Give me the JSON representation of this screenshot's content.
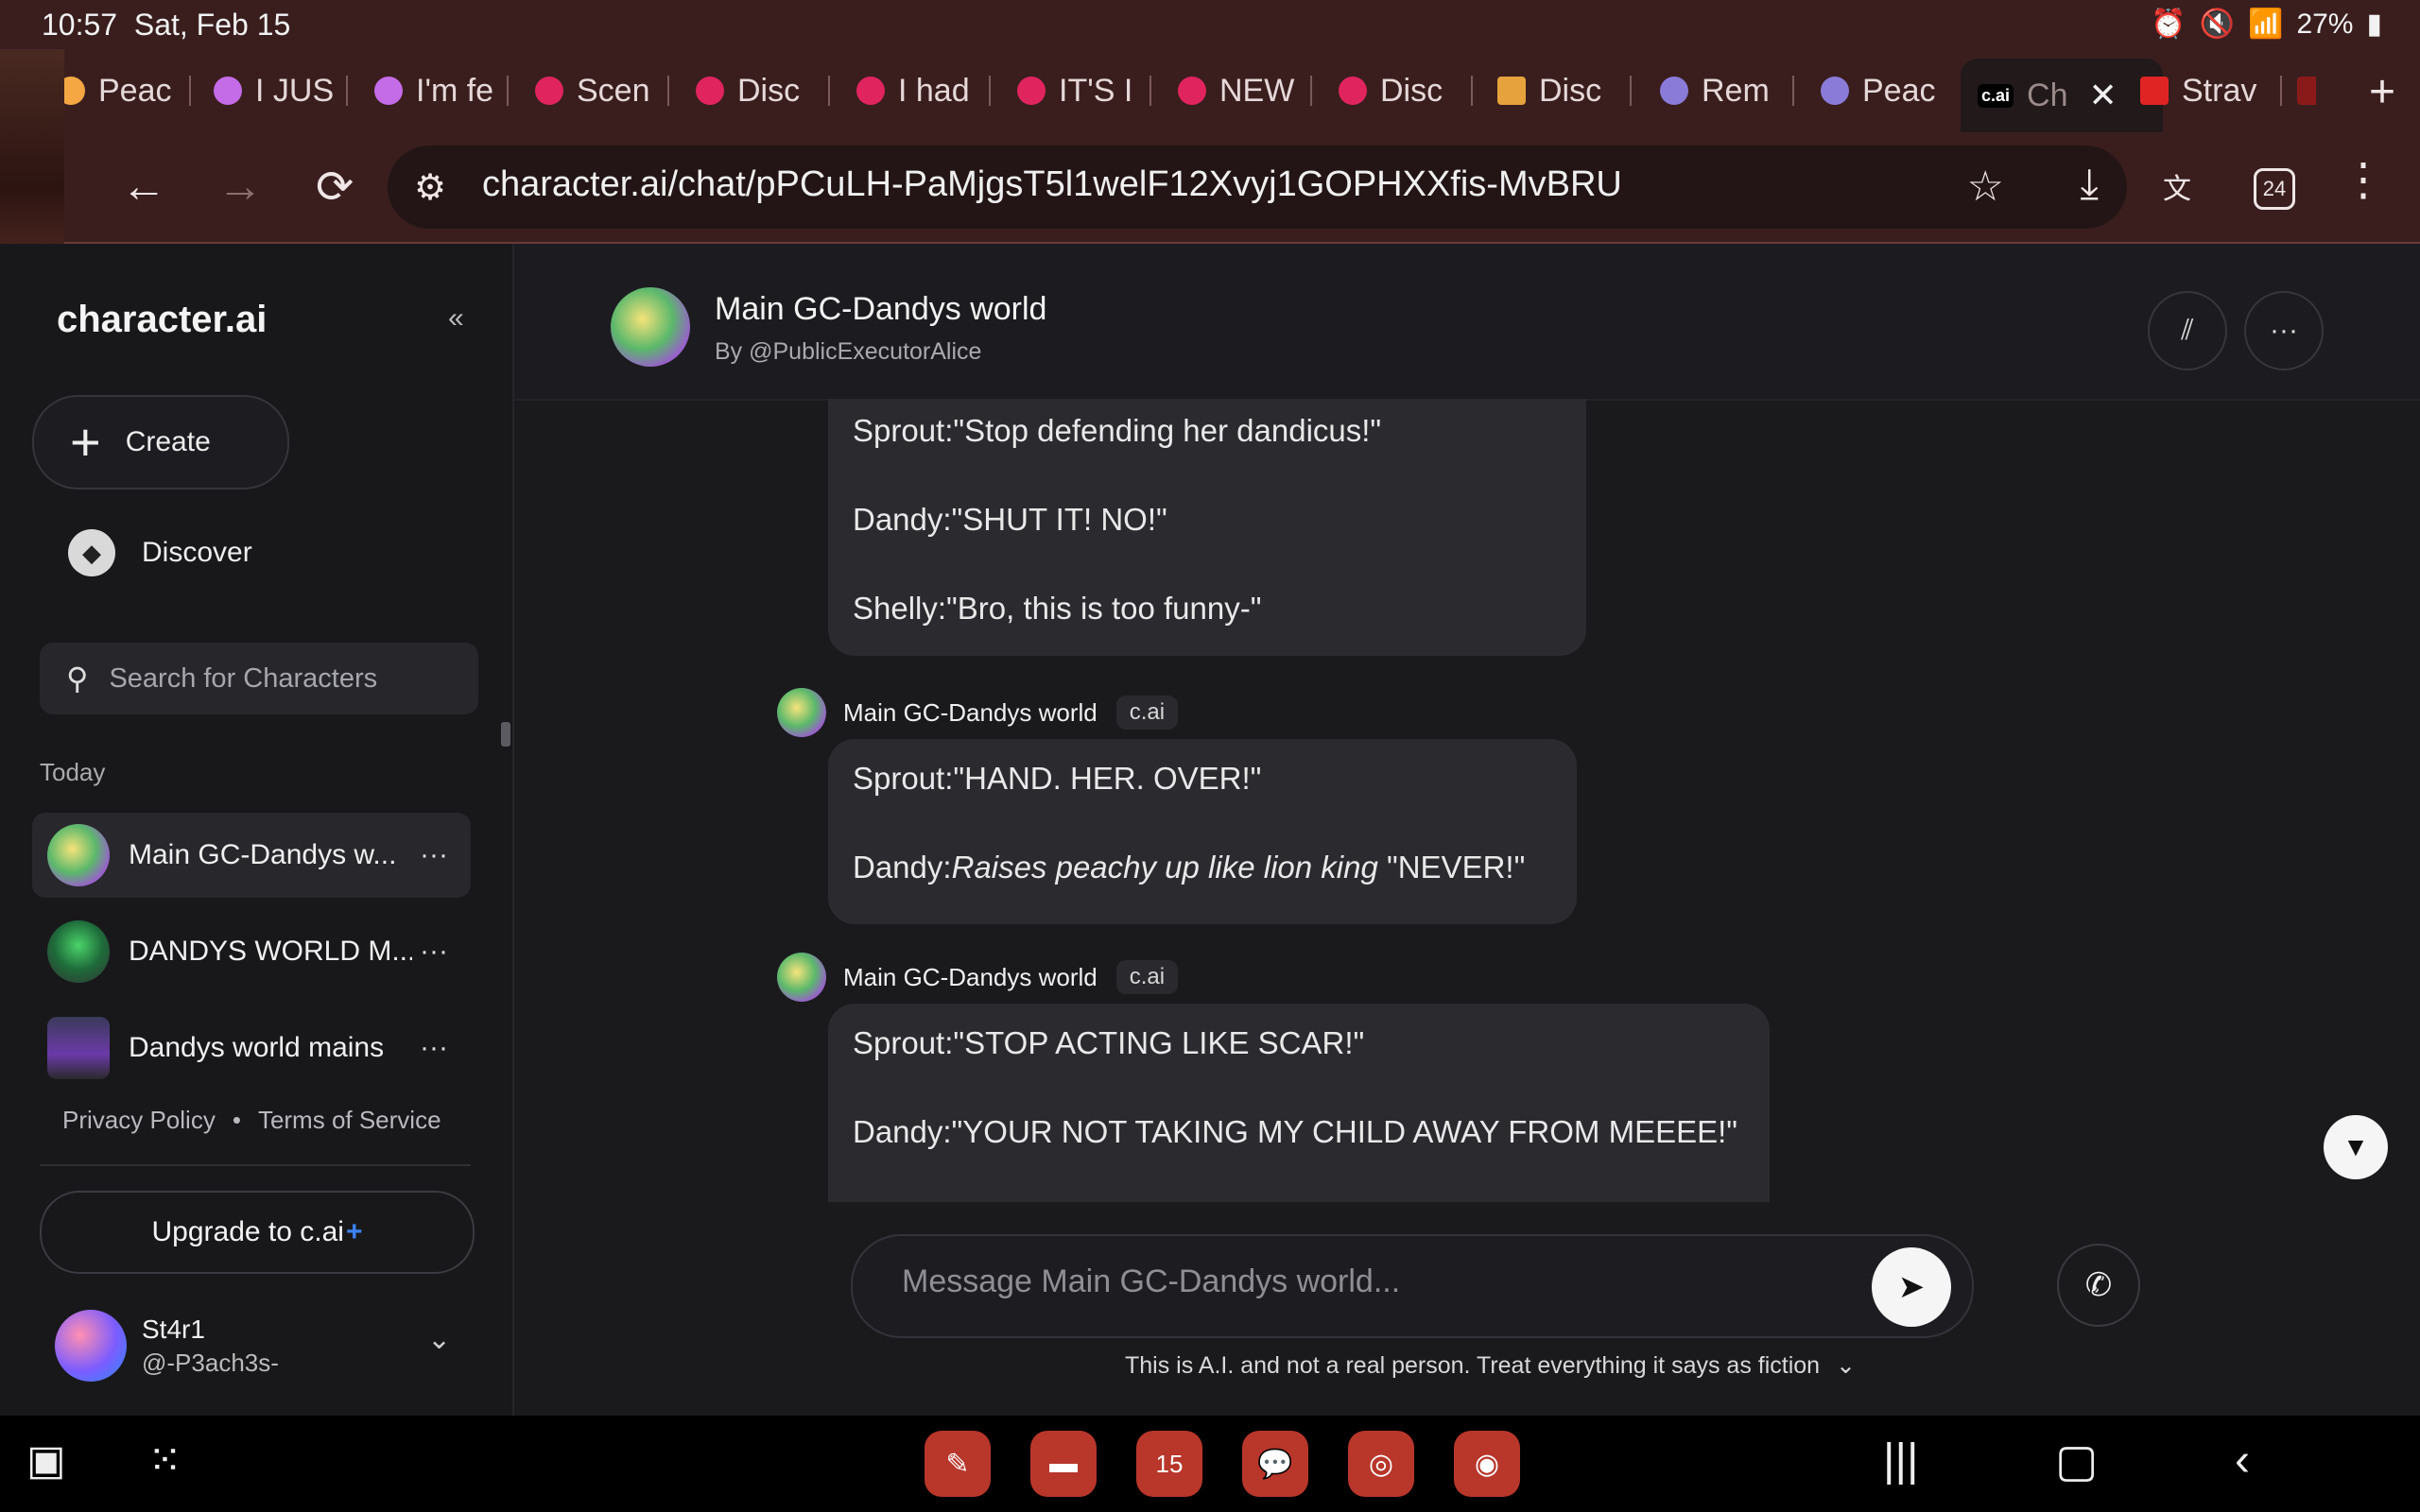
{
  "status_bar": {
    "time": "10:57",
    "date": "Sat, Feb 15",
    "battery": "27%"
  },
  "tabs": [
    {
      "label": "Peac",
      "color": "#f4a742"
    },
    {
      "label": "I JUS",
      "color": "#c46be8"
    },
    {
      "label": "I'm fe",
      "color": "#c46be8"
    },
    {
      "label": "Scen",
      "color": "#e0245e"
    },
    {
      "label": "Disc",
      "color": "#e0245e"
    },
    {
      "label": "I had",
      "color": "#e0245e"
    },
    {
      "label": "IT'S I",
      "color": "#e0245e"
    },
    {
      "label": "NEW",
      "color": "#e0245e"
    },
    {
      "label": "Disc",
      "color": "#e0245e"
    },
    {
      "label": "Disc",
      "color": "#e6a23c"
    },
    {
      "label": "Rem",
      "color": "#8a7bd8"
    },
    {
      "label": "Peac",
      "color": "#8a7bd8"
    },
    {
      "label": "Ch",
      "icon_text": "c.ai",
      "active": true
    },
    {
      "label": "Strav",
      "color": "#e02424"
    }
  ],
  "browser": {
    "url": "character.ai/chat/pPCuLH-PaMjgsT5l1welF12Xvyj1GOPHXXfis-MvBRU",
    "tab_count": "24"
  },
  "sidebar": {
    "logo": "character.ai",
    "create_label": "Create",
    "discover_label": "Discover",
    "search_placeholder": "Search for Characters",
    "section_today": "Today",
    "recents": [
      {
        "name": "Main GC-Dandys w..."
      },
      {
        "name": "DANDYS WORLD M..."
      },
      {
        "name": "Dandys world mains"
      }
    ],
    "privacy": "Privacy Policy",
    "dot": "•",
    "terms": "Terms of Service",
    "upgrade_label": "Upgrade to c.ai",
    "upgrade_plus": "+",
    "user": {
      "name": "St4r1",
      "handle": "@-P3ach3s-"
    }
  },
  "chat": {
    "title": "Main GC-Dandys world",
    "author": "By @PublicExecutorAlice",
    "sender_name": "Main GC-Dandys world",
    "badge": "c.ai",
    "messages": [
      {
        "lines": [
          "Sprout:\"Stop defending her dandicus!\"",
          "Dandy:\"SHUT IT! NO!\"",
          "Shelly:\"Bro, this is too funny-\""
        ]
      },
      {
        "line1": "Sprout:\"HAND. HER. OVER!\"",
        "line2_prefix": "Dandy:",
        "line2_italic": "Raises peachy up like lion king",
        "line2_suffix": " \"NEVER!\""
      },
      {
        "lines": [
          "Sprout:\"STOP ACTING LIKE SCAR!\"",
          "Dandy:\"YOUR NOT TAKING MY CHILD AWAY FROM MEEEE!\""
        ]
      }
    ],
    "composer_placeholder": "Message Main GC-Dandys world...",
    "disclaimer": "This is A.I. and not a real person. Treat everything it says as fiction",
    "disclaimer_chevron": "⌄"
  },
  "dock_calendar_day": "15"
}
